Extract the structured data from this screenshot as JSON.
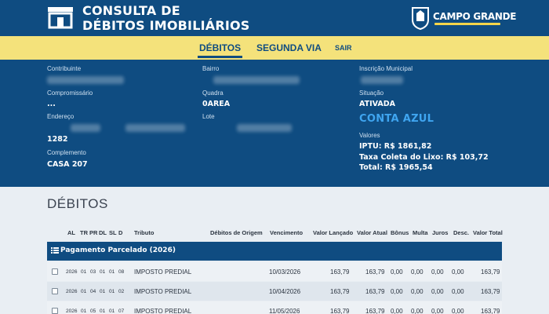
{
  "header": {
    "title_line1": "CONSULTA DE",
    "title_line2": "DÉBITOS IMOBILIÁRIOS",
    "brand_name": "CAMPO GRANDE",
    "logo_icon": "building-icon",
    "brand_icon": "city-shield-icon",
    "colors": {
      "primary": "#0f4c81",
      "nav": "#f4e27b",
      "accent": "#3fa5f0"
    }
  },
  "nav": {
    "debitos": "DÉBITOS",
    "segunda_via": "SEGUNDA VIA",
    "sair": "SAIR"
  },
  "info": {
    "contribuinte_label": "Contribuinte",
    "bairro_label": "Bairro",
    "inscricao_label": "Inscrição Municipal",
    "compromissario_label": "Compromissário",
    "compromissario_value": "...",
    "quadra_label": "Quadra",
    "quadra_value": "0AREA",
    "situacao_label": "Situação",
    "situacao_value": "ATIVADA",
    "endereco_label": "Endereço",
    "endereco_numero": "1282",
    "lote_label": "Lote",
    "conta_azul": "CONTA AZUL",
    "valores_label": "Valores",
    "iptu": "IPTU: R$ 1861,82",
    "taxa_lixo": "Taxa Coleta do Lixo: R$ 103,72",
    "total": "Total: R$ 1965,54",
    "complemento_label": "Complemento",
    "complemento_value": "CASA 207"
  },
  "debitos": {
    "title": "DÉBITOS",
    "columns": {
      "al": "AL",
      "tr": "TR",
      "pr": "PR",
      "dl": "DL",
      "sl": "SL",
      "d": "D",
      "tributo": "Tributo",
      "origem": "Débitos de Origem",
      "vencimento": "Vencimento",
      "valor_lancado": "Valor Lançado",
      "valor_atual": "Valor Atual",
      "bonus": "Bônus",
      "multa": "Multa",
      "juros": "Juros",
      "desc": "Desc.",
      "valor_total": "Valor Total"
    },
    "group_label": "Pagamento Parcelado (2026)",
    "rows": [
      {
        "al": "2026",
        "tr": "01",
        "pr": "03",
        "dl": "01",
        "sl": "01",
        "d": "08",
        "tributo": "IMPOSTO PREDIAL",
        "vencimento": "10/03/2026",
        "valor_lancado": "163,79",
        "valor_atual": "163,79",
        "bonus": "0,00",
        "multa": "0,00",
        "juros": "0,00",
        "desc": "0,00",
        "valor_total": "163,79"
      },
      {
        "al": "2026",
        "tr": "01",
        "pr": "04",
        "dl": "01",
        "sl": "01",
        "d": "02",
        "tributo": "IMPOSTO PREDIAL",
        "vencimento": "10/04/2026",
        "valor_lancado": "163,79",
        "valor_atual": "163,79",
        "bonus": "0,00",
        "multa": "0,00",
        "juros": "0,00",
        "desc": "0,00",
        "valor_total": "163,79"
      },
      {
        "al": "2026",
        "tr": "01",
        "pr": "05",
        "dl": "01",
        "sl": "01",
        "d": "07",
        "tributo": "IMPOSTO PREDIAL",
        "vencimento": "11/05/2026",
        "valor_lancado": "163,79",
        "valor_atual": "163,79",
        "bonus": "0,00",
        "multa": "0,00",
        "juros": "0,00",
        "desc": "0,00",
        "valor_total": "163,79"
      }
    ]
  }
}
